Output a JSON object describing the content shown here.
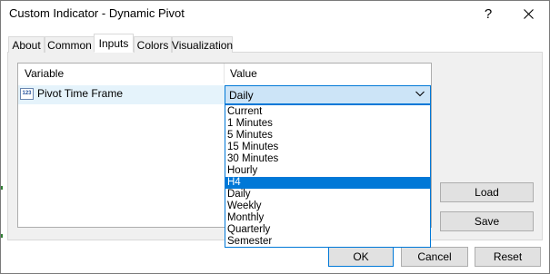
{
  "window": {
    "title": "Custom Indicator - Dynamic Pivot",
    "help_glyph": "?",
    "close_icon": "close-icon"
  },
  "tabs": [
    {
      "label": "About",
      "active": false
    },
    {
      "label": "Common",
      "active": false
    },
    {
      "label": "Inputs",
      "active": true
    },
    {
      "label": "Colors",
      "active": false
    },
    {
      "label": "Visualization",
      "active": false
    }
  ],
  "inputs": {
    "columns": {
      "variable": "Variable",
      "value": "Value"
    },
    "param_icon_text": "123",
    "rows": [
      {
        "variable": "Pivot Time Frame",
        "value": "Daily"
      }
    ]
  },
  "dropdown": {
    "options": [
      "Current",
      "1 Minutes",
      "5 Minutes",
      "15 Minutes",
      "30 Minutes",
      "Hourly",
      "H4",
      "Daily",
      "Weekly",
      "Monthly",
      "Quarterly",
      "Semester"
    ],
    "highlighted": "H4"
  },
  "buttons": {
    "load": "Load",
    "save": "Save",
    "ok": "OK",
    "cancel": "Cancel",
    "reset": "Reset"
  },
  "colors": {
    "accent": "#0078d7",
    "combo_bg": "#cce4f7",
    "row_bg": "#e5f3fb",
    "panel_bg": "#f0f0f0",
    "button_bg": "#e1e1e1"
  }
}
